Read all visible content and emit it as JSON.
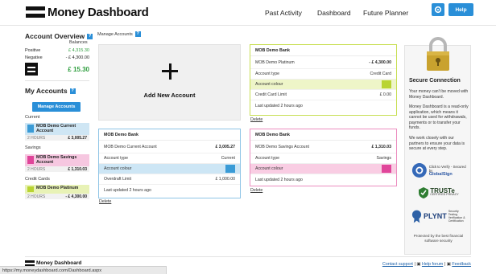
{
  "header": {
    "logo_text": "Money Dashboard",
    "nav": [
      "Past Activity",
      "Dashboard",
      "Future Planner"
    ],
    "help_label": "Help",
    "accent": "#2a8fd8"
  },
  "sidebar": {
    "overview_title": "Account Overview",
    "balances_label": "Balances",
    "positive_label": "Positive",
    "positive_value": "£ 4,315.30",
    "negative_label": "Negative",
    "negative_value": "- £ 4,300.00",
    "total_value": "£ 15.30",
    "my_accounts_title": "My Accounts",
    "manage_label": "Manage Accounts",
    "groups": [
      {
        "label": "Current",
        "accounts": [
          {
            "name": "MOB Demo Current Account",
            "age": "2 HOURS",
            "amount": "£ 3,005.27",
            "color": "#a8d3ec"
          }
        ]
      },
      {
        "label": "Savings",
        "accounts": [
          {
            "name": "MOB Demo Savings Account",
            "age": "2 HOURS",
            "amount": "£ 1,310.03",
            "color": "#f2a6cf"
          }
        ]
      },
      {
        "label": "Credit Cards",
        "accounts": [
          {
            "name": "MOB Demo Platinum",
            "age": "2 HOURS",
            "amount": "- £ 4,300.00",
            "color": "#d8ea7a"
          }
        ]
      }
    ]
  },
  "main": {
    "manage_title": "Manage Accounts",
    "add_new_label": "Add New Account",
    "cards": [
      {
        "bank": "MOB Demo Bank",
        "account_name": "MOB Demo Platinum",
        "balance": "- £ 4,300.00",
        "type_label": "Account type",
        "type_value": "Credit Card",
        "colour_label": "Account colour",
        "extra_label": "Credit Card Limit",
        "extra_value": "£ 0.00",
        "updated": "Last updated 2 hours ago",
        "delete_label": "Delete",
        "border": "#c8df54",
        "tint": "#eef5c8",
        "swatch": "#b9d433"
      },
      {
        "bank": "MOB Demo Bank",
        "account_name": "MOB Demo Current Account",
        "balance": "£ 3,005.27",
        "type_label": "Account type",
        "type_value": "Current",
        "colour_label": "Account colour",
        "extra_label": "Overdraft Limit",
        "extra_value": "£ 1,000.00",
        "updated": "Last updated 2 hours ago",
        "delete_label": "Delete",
        "border": "#8ec4e6",
        "tint": "#cde6f5",
        "swatch": "#3a9bd6"
      },
      {
        "bank": "MOB Demo Bank",
        "account_name": "MOB Demo Savings Account",
        "balance": "£ 1,310.03",
        "type_label": "Account type",
        "type_value": "Savings",
        "colour_label": "Account colour",
        "updated": "Last updated 2 hours ago",
        "delete_label": "Delete",
        "border": "#ec8dbf",
        "tint": "#f9cde3",
        "swatch": "#e0459a"
      }
    ]
  },
  "right_panel": {
    "title": "Secure Connection",
    "p1": "Your money can't be moved with Money Dashboard.",
    "p2": "Money Dashboard is a read-only application, which means it cannot be used for withdrawals, payments or to transfer your funds.",
    "p3": "We work closely with our partners to ensure your data is secure at every step.",
    "badges": [
      {
        "name": "globalsign",
        "title": "GlobalSign",
        "sub": "Click to Verify - Secured by"
      },
      {
        "name": "truste",
        "title": "TRUSTe",
        "sub": "CERTIFIED PRIVACY"
      },
      {
        "name": "plynt",
        "title": "PLYNT",
        "sub": "Security Testing Verification & Certification"
      }
    ],
    "protected_text": "Protected by the best financial software security"
  },
  "footer": {
    "logo_text": "Money Dashboard",
    "contact": "Contact support",
    "help_forum": "Help forum",
    "feedback": "Feedback",
    "status_url": "https://my.moneydashboard.com/Dashboard.aspx"
  }
}
